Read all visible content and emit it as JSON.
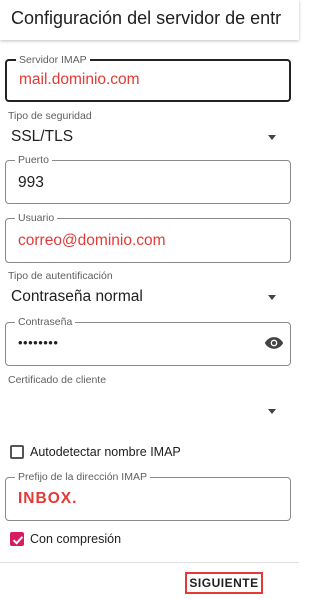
{
  "appbar": {
    "title": "Configuración del servidor de entr"
  },
  "imap_server": {
    "label": "Servidor IMAP",
    "value": "mail.dominio.com"
  },
  "security": {
    "label": "Tipo de seguridad",
    "value": "SSL/TLS"
  },
  "port": {
    "label": "Puerto",
    "value": "993"
  },
  "user": {
    "label": "Usuario",
    "value": "correo@dominio.com"
  },
  "auth": {
    "label": "Tipo de autentificación",
    "value": "Contraseña normal"
  },
  "password": {
    "label": "Contraseña",
    "value": "••••••••",
    "icon": "eye-icon"
  },
  "client_cert": {
    "label": "Certificado de cliente",
    "value": ""
  },
  "autodetect": {
    "label": "Autodetectar nombre IMAP",
    "checked": false
  },
  "prefix": {
    "label": "Prefijo de la dirección IMAP",
    "value": "INBOX."
  },
  "compression": {
    "label": "Con compresión",
    "checked": true
  },
  "footer": {
    "next_label": "SIGUIENTE"
  },
  "colors": {
    "accent": "#d81b60",
    "highlight_red": "#e53935"
  }
}
